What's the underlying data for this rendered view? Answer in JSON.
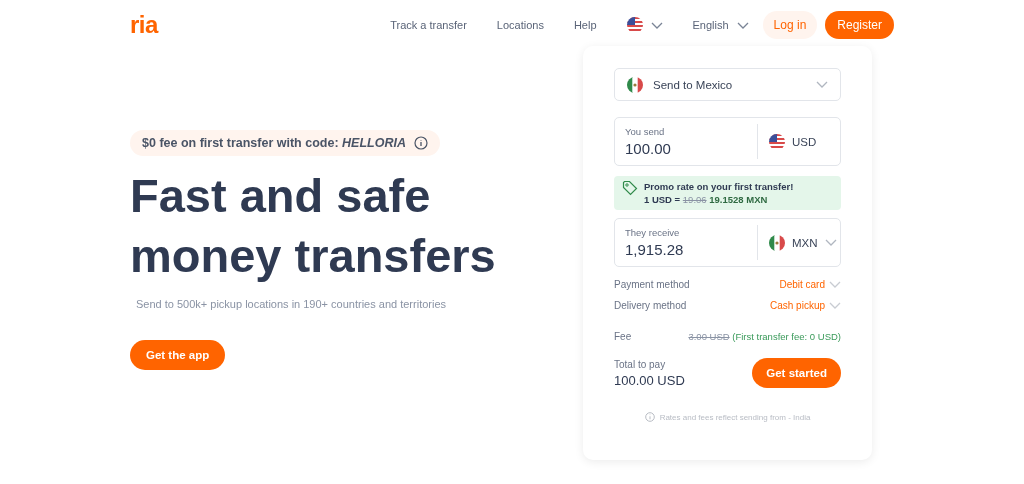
{
  "header": {
    "logo": "ria",
    "nav": [
      "Track a transfer",
      "Locations",
      "Help"
    ],
    "language": "English",
    "login": "Log in",
    "register": "Register"
  },
  "hero": {
    "promo": "$0 fee on first transfer with code: *HELLORIA*",
    "headline": [
      "Fast and safe",
      "money transfers"
    ],
    "subtitle": "Send to 500k+ pickup locations in 190+ countries and territories",
    "cta": "Get the app"
  },
  "calculator": {
    "destination": "Send to Mexico",
    "send": {
      "label": "You send",
      "value": "100.00",
      "currency": "USD",
      "kind": "us",
      "dropdown": false
    },
    "promo_rate": {
      "title": "Promo rate on your first transfer!",
      "prefix": "1 USD =",
      "old_rate": "19.06",
      "new_rate": "19.1528 MXN"
    },
    "receive": {
      "label": "They receive",
      "value": "1,915.28",
      "currency": "MXN",
      "kind": "mx",
      "dropdown": true
    },
    "methods": [
      {
        "label": "Payment method",
        "value": "Debit card"
      },
      {
        "label": "Delivery method",
        "value": "Cash pickup"
      }
    ],
    "fee": {
      "label": "Fee",
      "old": "3.00 USD",
      "note": "(First transfer fee: 0 USD)"
    },
    "total": {
      "label": "Total to pay",
      "value": "100.00 USD"
    },
    "button": "Get started",
    "footnote": "Rates and fees reflect sending from - India"
  }
}
